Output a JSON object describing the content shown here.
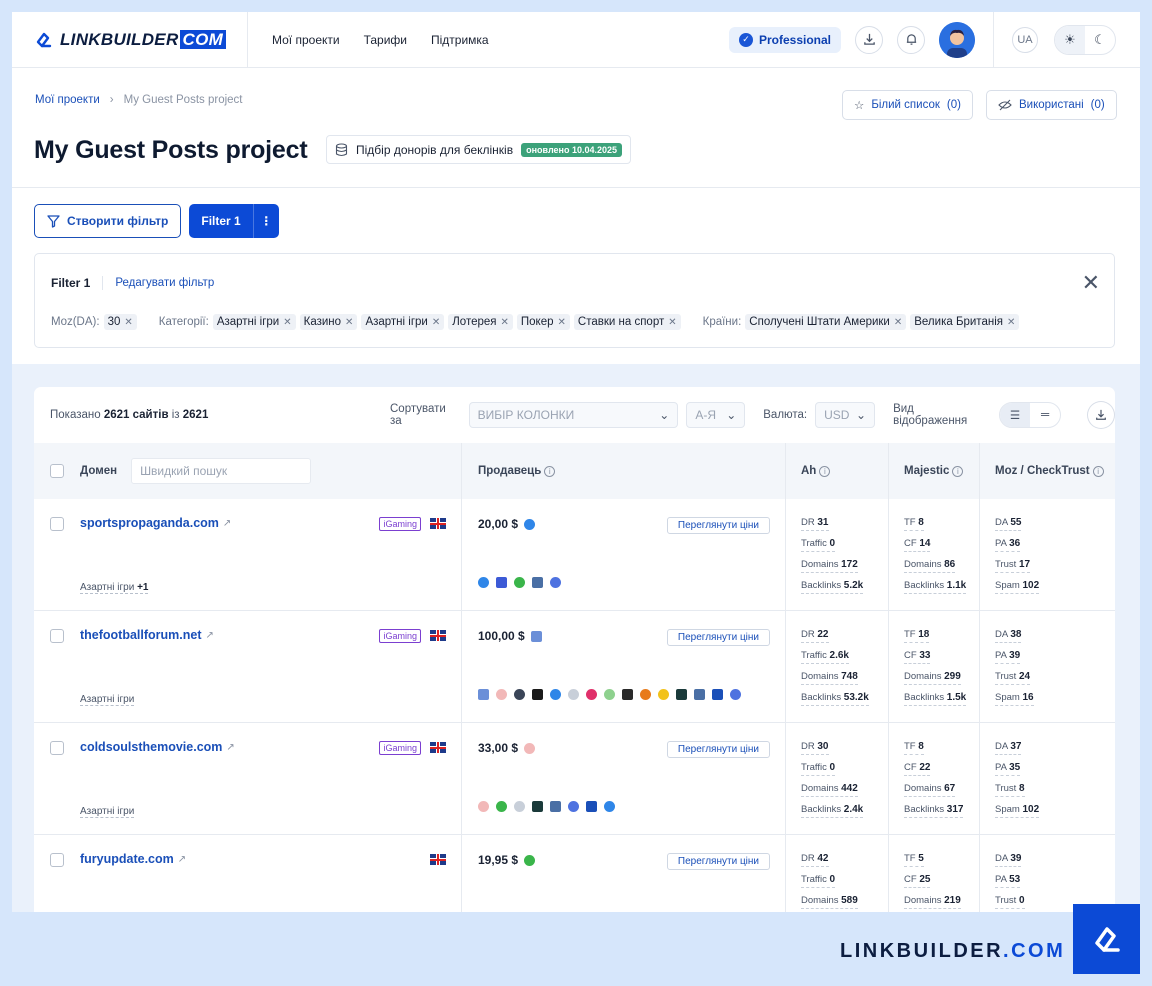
{
  "header": {
    "logo_text": "LINKBUILDER",
    "logo_com": "COM",
    "nav": [
      "Мої проекти",
      "Тарифи",
      "Підтримка"
    ],
    "plan_badge": "Professional",
    "lang": "UA"
  },
  "breadcrumb": {
    "root": "Мої проекти",
    "current": "My Guest Posts project"
  },
  "page": {
    "title": "My Guest Posts project",
    "tool_label": "Підбір донорів для беклінків",
    "updated_badge": "оновлено 10.04.2025",
    "whitelist_label": "Білий список",
    "whitelist_count": "(0)",
    "used_label": "Використані",
    "used_count": "(0)"
  },
  "filters": {
    "create_label": "Створити фільтр",
    "active_label": "Filter 1",
    "card_title": "Filter 1",
    "edit_label": "Редагувати фільтр",
    "moz_label": "Moz(DA):",
    "moz_value": "30",
    "categories_label": "Категорії:",
    "categories": [
      "Азартні ігри",
      "Казино",
      "Азартні ігри",
      "Лотерея",
      "Покер",
      "Ставки на спорт"
    ],
    "countries_label": "Країни:",
    "countries": [
      "Сполучені Штати Америки",
      "Велика Британія"
    ]
  },
  "table_controls": {
    "shown_prefix": "Показано",
    "shown_count": "2621 сайтів",
    "shown_mid": "із",
    "shown_total": "2621",
    "sort_label": "Сортувати за",
    "sort_value": "ВИБІР КОЛОНКИ",
    "order_value": "А-Я",
    "currency_label": "Валюта:",
    "currency_value": "USD",
    "view_label": "Вид відображення"
  },
  "columns": {
    "domain": "Домен",
    "quick_search_placeholder": "Швидкий пошук",
    "seller": "Продавець",
    "ah": "Ah",
    "majestic": "Majestic",
    "moz": "Moz / CheckTrust"
  },
  "rows": [
    {
      "domain": "sportspropaganda.com",
      "igaming": "iGaming",
      "category": "Азартні ігри",
      "category_extra": "+1",
      "price": "20,00 $",
      "view_prices": "Переглянути ціни",
      "ah": {
        "DR": "31",
        "Traffic": "0",
        "Domains": "172",
        "Backlinks": "5.2k"
      },
      "majestic": {
        "TF": "8",
        "CF": "14",
        "Domains": "86",
        "Backlinks": "1.1k"
      },
      "moz": {
        "DA": "55",
        "PA": "36",
        "Trust": "17",
        "Spam": "102"
      }
    },
    {
      "domain": "thefootballforum.net",
      "igaming": "iGaming",
      "category": "Азартні ігри",
      "category_extra": "",
      "price": "100,00 $",
      "view_prices": "Переглянути ціни",
      "ah": {
        "DR": "22",
        "Traffic": "2.6k",
        "Domains": "748",
        "Backlinks": "53.2k"
      },
      "majestic": {
        "TF": "18",
        "CF": "33",
        "Domains": "299",
        "Backlinks": "1.5k"
      },
      "moz": {
        "DA": "38",
        "PA": "39",
        "Trust": "24",
        "Spam": "16"
      }
    },
    {
      "domain": "coldsoulsthemovie.com",
      "igaming": "iGaming",
      "category": "Азартні ігри",
      "category_extra": "",
      "price": "33,00 $",
      "view_prices": "Переглянути ціни",
      "ah": {
        "DR": "30",
        "Traffic": "0",
        "Domains": "442",
        "Backlinks": "2.4k"
      },
      "majestic": {
        "TF": "8",
        "CF": "22",
        "Domains": "67",
        "Backlinks": "317"
      },
      "moz": {
        "DA": "37",
        "PA": "35",
        "Trust": "8",
        "Spam": "102"
      }
    },
    {
      "domain": "furyupdate.com",
      "igaming": "",
      "category": "",
      "category_extra": "",
      "price": "19,95 $",
      "view_prices": "Переглянути ціни",
      "ah": {
        "DR": "42",
        "Traffic": "0",
        "Domains": "589",
        "Backlinks": ""
      },
      "majestic": {
        "TF": "5",
        "CF": "25",
        "Domains": "219",
        "Backlinks": ""
      },
      "moz": {
        "DA": "39",
        "PA": "53",
        "Trust": "0",
        "Spam": ""
      }
    }
  ],
  "footer": {
    "brand_text": "LINKBUILDER",
    "brand_dot": ".",
    "brand_com": "COM"
  },
  "colors": {
    "accent": "#0c4ad6",
    "link": "#1a4fb8",
    "updated": "#3ca27a",
    "igaming": "#7b3fd0"
  },
  "icons": [
    "filter-icon",
    "download-icon",
    "bell-icon",
    "sun-icon",
    "moon-icon",
    "star-icon",
    "eye-off-icon",
    "database-icon",
    "close-icon",
    "chevron-right-icon",
    "chevron-down-icon",
    "list-view-icon",
    "compact-view-icon",
    "external-link-icon",
    "info-icon"
  ]
}
